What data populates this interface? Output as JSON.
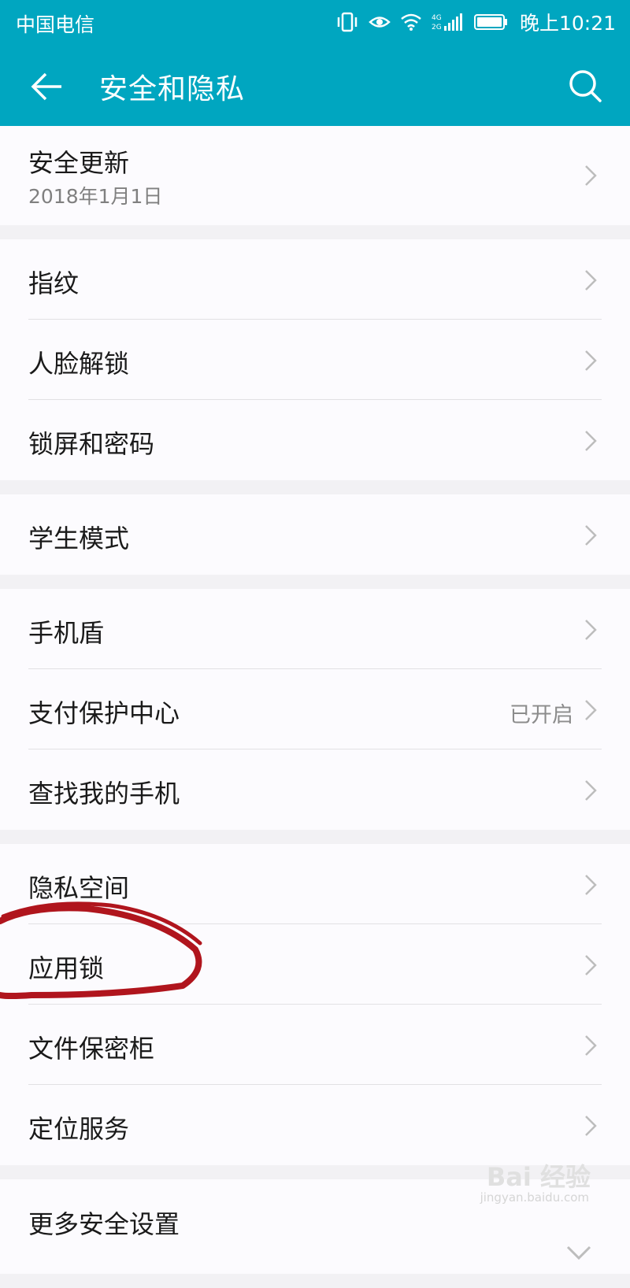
{
  "status_bar": {
    "carrier": "中国电信",
    "time": "晚上10:21",
    "icons": [
      "vibrate-icon",
      "eye-icon",
      "wifi-icon",
      "signal-icon",
      "battery-icon"
    ]
  },
  "app_bar": {
    "title": "安全和隐私",
    "back_icon": "back-arrow-icon",
    "search_icon": "search-icon",
    "color": "#00a6c0"
  },
  "groups": [
    {
      "items": [
        {
          "label": "安全更新",
          "sub": "2018年1月1日"
        }
      ]
    },
    {
      "items": [
        {
          "label": "指纹"
        },
        {
          "label": "人脸解锁"
        },
        {
          "label": "锁屏和密码"
        }
      ]
    },
    {
      "items": [
        {
          "label": "学生模式"
        }
      ]
    },
    {
      "items": [
        {
          "label": "手机盾"
        },
        {
          "label": "支付保护中心",
          "status": "已开启"
        },
        {
          "label": "查找我的手机"
        }
      ]
    },
    {
      "items": [
        {
          "label": "隐私空间"
        },
        {
          "label": "应用锁"
        },
        {
          "label": "文件保密柜"
        },
        {
          "label": "定位服务"
        }
      ]
    },
    {
      "items": [
        {
          "label": "更多安全设置"
        }
      ]
    }
  ],
  "annotation_color": "#b0151d",
  "watermark": {
    "brand": "Bai 经验",
    "url": "jingyan.baidu.com"
  }
}
